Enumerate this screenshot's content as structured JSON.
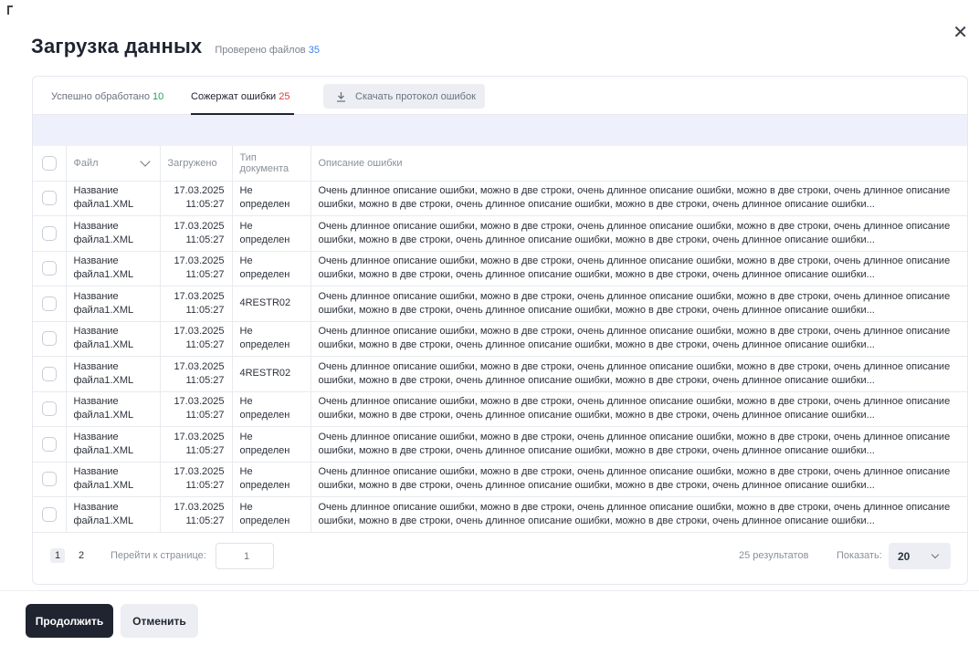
{
  "dialog": {
    "title": "Загрузка данных",
    "checked_label": "Проверено файлов",
    "checked_count": "35",
    "close_icon": "close-icon"
  },
  "tabs": {
    "success_label": "Успешно обработано",
    "success_count": "10",
    "errors_label": "Сожержат ошибки",
    "errors_count": "25",
    "active": "errors"
  },
  "download": {
    "label": "Скачать протокол ошибок",
    "icon": "download-icon"
  },
  "table": {
    "headers": {
      "file": "Файл",
      "uploaded": "Загружено",
      "doc_type_line1": "Тип",
      "doc_type_line2": "документа",
      "description": "Описание ошибки"
    },
    "rows": [
      {
        "file": "Название файла1.XML",
        "date": "17.03.2025",
        "time": "11:05:27",
        "type1": "Не",
        "type2": "определен",
        "desc": "Очень длинное описание ошибки, можно в две строки, очень длинное описание ошибки, можно в две строки, очень длинное описание ошибки, можно в две строки, очень длинное описание ошибки, можно в две строки, очень длинное описание ошибки..."
      },
      {
        "file": "Название файла1.XML",
        "date": "17.03.2025",
        "time": "11:05:27",
        "type1": "Не",
        "type2": "определен",
        "desc": "Очень длинное описание ошибки, можно в две строки, очень длинное описание ошибки, можно в две строки, очень длинное описание ошибки, можно в две строки, очень длинное описание ошибки, можно в две строки, очень длинное описание ошибки..."
      },
      {
        "file": "Название файла1.XML",
        "date": "17.03.2025",
        "time": "11:05:27",
        "type1": "Не",
        "type2": "определен",
        "desc": "Очень длинное описание ошибки, можно в две строки, очень длинное описание ошибки, можно в две строки, очень длинное описание ошибки, можно в две строки, очень длинное описание ошибки, можно в две строки, очень длинное описание ошибки..."
      },
      {
        "file": "Название файла1.XML",
        "date": "17.03.2025",
        "time": "11:05:27",
        "type1": "4RESTR02",
        "type2": "",
        "desc": "Очень длинное описание ошибки, можно в две строки, очень длинное описание ошибки, можно в две строки, очень длинное описание ошибки, можно в две строки, очень длинное описание ошибки, можно в две строки, очень длинное описание ошибки..."
      },
      {
        "file": "Название файла1.XML",
        "date": "17.03.2025",
        "time": "11:05:27",
        "type1": "Не",
        "type2": "определен",
        "desc": "Очень длинное описание ошибки, можно в две строки, очень длинное описание ошибки, можно в две строки, очень длинное описание ошибки, можно в две строки, очень длинное описание ошибки, можно в две строки, очень длинное описание ошибки..."
      },
      {
        "file": "Название файла1.XML",
        "date": "17.03.2025",
        "time": "11:05:27",
        "type1": "4RESTR02",
        "type2": "",
        "desc": "Очень длинное описание ошибки, можно в две строки, очень длинное описание ошибки, можно в две строки, очень длинное описание ошибки, можно в две строки, очень длинное описание ошибки, можно в две строки, очень длинное описание ошибки..."
      },
      {
        "file": "Название файла1.XML",
        "date": "17.03.2025",
        "time": "11:05:27",
        "type1": "Не",
        "type2": "определен",
        "desc": "Очень длинное описание ошибки, можно в две строки, очень длинное описание ошибки, можно в две строки, очень длинное описание ошибки, можно в две строки, очень длинное описание ошибки, можно в две строки, очень длинное описание ошибки..."
      },
      {
        "file": "Название файла1.XML",
        "date": "17.03.2025",
        "time": "11:05:27",
        "type1": "Не",
        "type2": "определен",
        "desc": "Очень длинное описание ошибки, можно в две строки, очень длинное описание ошибки, можно в две строки, очень длинное описание ошибки, можно в две строки, очень длинное описание ошибки, можно в две строки, очень длинное описание ошибки..."
      },
      {
        "file": "Название файла1.XML",
        "date": "17.03.2025",
        "time": "11:05:27",
        "type1": "Не",
        "type2": "определен",
        "desc": "Очень длинное описание ошибки, можно в две строки, очень длинное описание ошибки, можно в две строки, очень длинное описание ошибки, можно в две строки, очень длинное описание ошибки, можно в две строки, очень длинное описание ошибки..."
      },
      {
        "file": "Название файла1.XML",
        "date": "17.03.2025",
        "time": "11:05:27",
        "type1": "Не",
        "type2": "определен",
        "desc": "Очень длинное описание ошибки, можно в две строки, очень длинное описание ошибки, можно в две строки, очень длинное описание ошибки, можно в две строки, очень длинное описание ошибки, можно в две строки, очень длинное описание ошибки..."
      }
    ]
  },
  "pagination": {
    "pages": [
      "1",
      "2"
    ],
    "current_page": "1",
    "goto_label": "Перейти к странице:",
    "goto_placeholder": "1",
    "results": "25 результатов",
    "show_label": "Показать:",
    "page_size": "20"
  },
  "footer": {
    "continue_label": "Продолжить",
    "cancel_label": "Отменить"
  },
  "colors": {
    "success": "#22a559",
    "error": "#e03b3b",
    "accent": "#3b82f6",
    "primary_button": "#1f2430"
  }
}
